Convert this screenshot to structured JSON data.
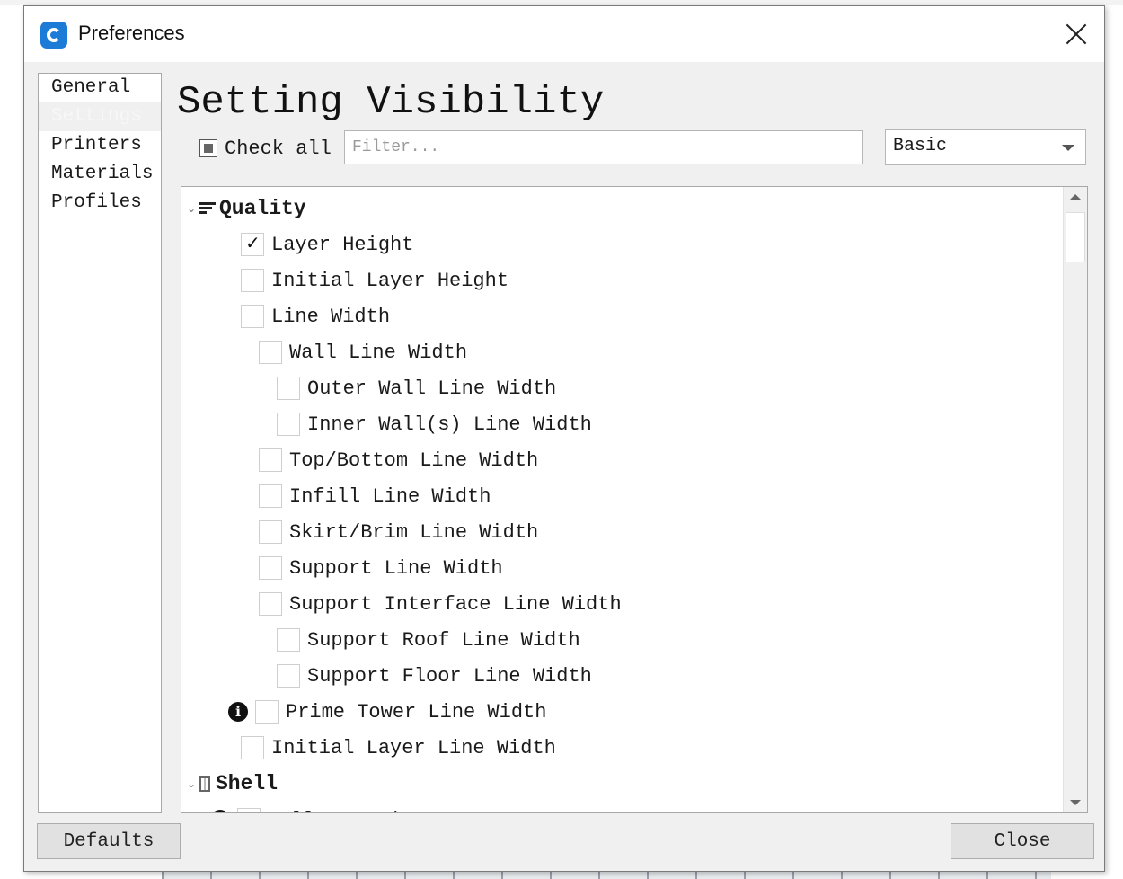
{
  "window": {
    "title": "Preferences"
  },
  "nav": {
    "items": [
      {
        "label": "General",
        "active": false
      },
      {
        "label": "Settings",
        "active": true
      },
      {
        "label": "Printers",
        "active": false
      },
      {
        "label": "Materials",
        "active": false
      },
      {
        "label": "Profiles",
        "active": false
      }
    ]
  },
  "main": {
    "title": "Setting Visibility",
    "check_all_label": "Check all",
    "filter_placeholder": "Filter...",
    "preset_value": "Basic"
  },
  "tree": {
    "categories": [
      {
        "label": "Quality",
        "icon": "quality-icon",
        "settings": [
          {
            "label": "Layer Height",
            "checked": true,
            "depth": 0,
            "info": false
          },
          {
            "label": "Initial Layer Height",
            "checked": false,
            "depth": 0,
            "info": false
          },
          {
            "label": "Line Width",
            "checked": false,
            "depth": 0,
            "info": false
          },
          {
            "label": "Wall Line Width",
            "checked": false,
            "depth": 1,
            "info": false
          },
          {
            "label": "Outer Wall Line Width",
            "checked": false,
            "depth": 2,
            "info": false
          },
          {
            "label": "Inner Wall(s) Line Width",
            "checked": false,
            "depth": 2,
            "info": false
          },
          {
            "label": "Top/Bottom Line Width",
            "checked": false,
            "depth": 1,
            "info": false
          },
          {
            "label": "Infill Line Width",
            "checked": false,
            "depth": 1,
            "info": false
          },
          {
            "label": "Skirt/Brim Line Width",
            "checked": false,
            "depth": 1,
            "info": false
          },
          {
            "label": "Support Line Width",
            "checked": false,
            "depth": 1,
            "info": false
          },
          {
            "label": "Support Interface Line Width",
            "checked": false,
            "depth": 1,
            "info": false
          },
          {
            "label": "Support Roof Line Width",
            "checked": false,
            "depth": 2,
            "info": false
          },
          {
            "label": "Support Floor Line Width",
            "checked": false,
            "depth": 2,
            "info": false
          },
          {
            "label": "Prime Tower Line Width",
            "checked": false,
            "depth": 1,
            "info": true
          },
          {
            "label": "Initial Layer Line Width",
            "checked": false,
            "depth": 0,
            "info": false
          }
        ]
      },
      {
        "label": "Shell",
        "icon": "shell-icon",
        "settings": [
          {
            "label": "Wall Extruder",
            "checked": false,
            "depth": 0,
            "info": true
          }
        ]
      }
    ]
  },
  "footer": {
    "defaults_label": "Defaults",
    "close_label": "Close"
  },
  "colors": {
    "dialog_bg": "#f0f0f0",
    "brand": "#1c7bd6"
  }
}
